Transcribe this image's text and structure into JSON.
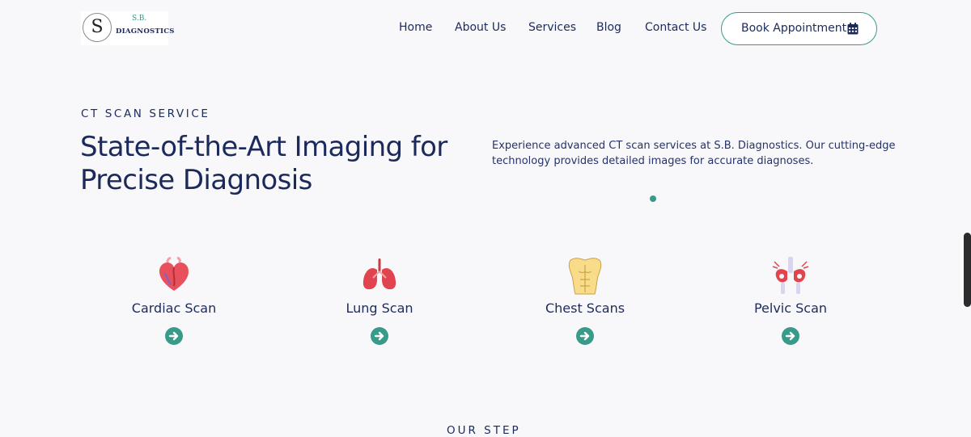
{
  "logo": {
    "monogram": "S",
    "small": "S.B.",
    "name": "DIAGNOSTICS"
  },
  "nav": {
    "links": [
      "Home",
      "About Us",
      "Services",
      "Blog",
      "Contact Us"
    ],
    "cta": "Book Appointment",
    "cta_icon": "calendar-icon"
  },
  "hero": {
    "eyebrow": "CT SCAN SERVICE",
    "title_line1": "State-of-the-Art Imaging for",
    "title_line2": "Precise Diagnosis",
    "description": "Experience advanced CT scan services at S.B. Diagnostics. Our cutting-edge technology provides detailed images for accurate diagnoses."
  },
  "services": [
    {
      "label": "Cardiac Scan",
      "icon": "heart-icon"
    },
    {
      "label": "Lung Scan",
      "icon": "lungs-icon"
    },
    {
      "label": "Chest Scans",
      "icon": "chest-icon"
    },
    {
      "label": "Pelvic Scan",
      "icon": "pelvis-icon"
    }
  ],
  "next_section": {
    "eyebrow": "OUR STEP"
  },
  "colors": {
    "accent": "#3a9a8a",
    "navy": "#1c2a5b",
    "background": "#f8f8fa"
  }
}
